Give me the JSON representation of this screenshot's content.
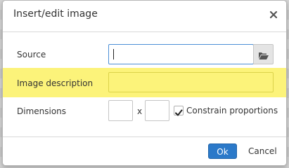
{
  "dialog": {
    "title": "Insert/edit image",
    "close_icon": "close-icon"
  },
  "form": {
    "source_label": "Source",
    "source_value": "",
    "browse_icon": "folder-open-icon",
    "description_label": "Image description",
    "description_value": "",
    "dimensions_label": "Dimensions",
    "width_value": "",
    "dimension_separator": "x",
    "height_value": "",
    "constrain_label": "Constrain proportions",
    "constrain_checked": true
  },
  "footer": {
    "ok_label": "Ok",
    "cancel_label": "Cancel"
  },
  "colors": {
    "highlight": "#fcf37a",
    "primary_button": "#2b79c9",
    "focus_border": "#4c8fd6"
  }
}
